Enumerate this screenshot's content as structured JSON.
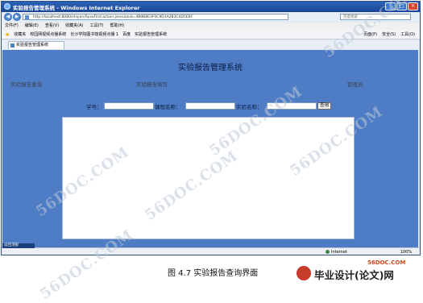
{
  "window": {
    "title": "实验报告管理系统 - Windows Internet Explorer",
    "address": "http://localhost:8080/shiyan/SyxxFind.action;jsessionid=4B9B8E3F0C9D1A2B3C4D5E6F",
    "search_placeholder": "百度搜索",
    "menu": [
      "文件(F)",
      "编辑(E)",
      "查看(V)",
      "收藏夹(A)",
      "工具(T)",
      "帮助(H)"
    ],
    "favorites_label": "收藏夹",
    "favorites": [
      "校园网视频点播系统",
      "长沙学院图书馆视频点播 1",
      "百度",
      "实验报告管理系统"
    ],
    "command": [
      "页面(P)",
      "安全(S)",
      "工具(O)"
    ],
    "tab_label": "实验报告管理系统"
  },
  "page": {
    "system_title": "实验报告管理系统",
    "nav": [
      "实验报告查询",
      "实验报告填写",
      "管理员"
    ],
    "form": {
      "student_id_label": "学号：",
      "course_label": "课程名称：",
      "experiment_label": "实验名称：",
      "query_button": "查询"
    }
  },
  "status": {
    "left": "返回顶部",
    "zone": "Internet",
    "zoom": "100%"
  },
  "caption": "图 4.7 实验报告查询界面",
  "watermark": "56DOC.COM",
  "logo": {
    "site": "56DOC.COM",
    "text": "毕业设计(论文)网"
  }
}
